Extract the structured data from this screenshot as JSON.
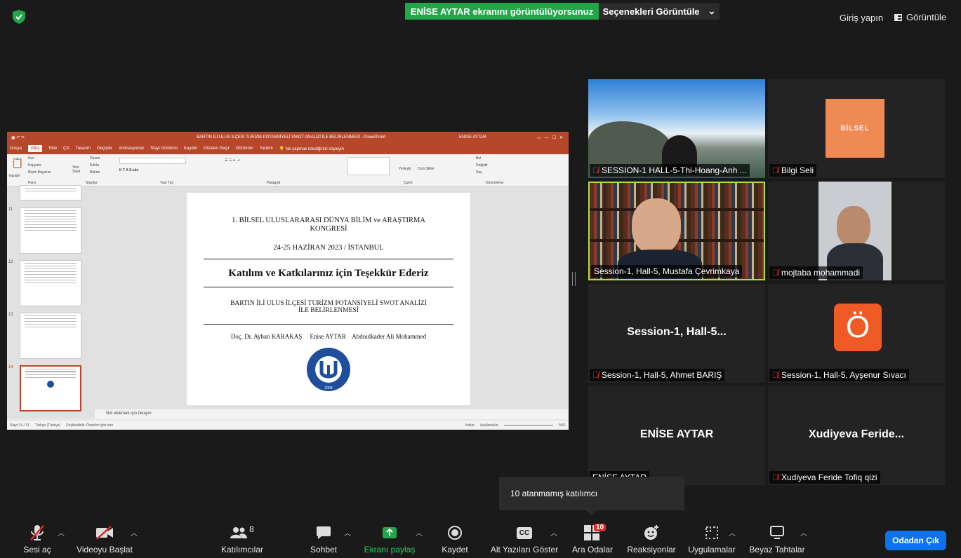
{
  "header": {
    "share_banner": "ENİSE AYTAR ekranını görüntülüyorsunuz",
    "view_options": "Seçenekleri Görüntüle",
    "sign_in": "Giriş yapın",
    "view_button": "Görüntüle"
  },
  "ppt": {
    "title": "BARTIN İLİ ULUS İLÇESİ TURİZM POTANSİYELİ SWOT ANALİZİ İLE BELİRLENMESİ  -  PowerPoint",
    "user": "ENİSE AYTAR",
    "menu": [
      "Dosya",
      "Giriş",
      "Ekle",
      "Çiz",
      "Tasarım",
      "Geçişler",
      "Animasyonlar",
      "Slayt Gösterisi",
      "Kaydet",
      "Gözden Geçir",
      "Görünüm",
      "Yardım"
    ],
    "search_hint": "Ne yapmak istediğinizi söyleyin",
    "ribbon_groups": [
      "Pano",
      "Slaytlar",
      "Yazı Tipi",
      "Paragraf",
      "Çizim",
      "Düzenleme"
    ],
    "ribbon_items": {
      "cut": "Kes",
      "copy": "Kopyala",
      "format_painter": "Biçim Boyacısı",
      "paste": "Yapıştır",
      "new_slide": "Yeni Slayt",
      "layout": "Düzen",
      "reset": "Sıfırla",
      "section": "Bölüm",
      "find": "Bul",
      "replace": "Değiştir",
      "select": "Seç",
      "arrange": "Yerleştir",
      "quick_styles": "Hızlı Stiller"
    },
    "thumb_numbers": [
      "11",
      "12",
      "13",
      "14"
    ],
    "notes_placeholder": "Not eklemek için tıklayın",
    "status_left": "Slayt 14 / 14",
    "status_lang": "Türkçe (Türkiye)",
    "status_access": "Erişilebilirlik: Önerileri göz atın",
    "status_notes": "Notlar",
    "status_comments": "Açıklamalar",
    "zoom": "%61"
  },
  "slide": {
    "line1": "1.  BİLSEL ULUSLARARASI DÜNYA BİLİM ve ARAŞTIRMA",
    "line2": "KONGRESİ",
    "date": "24-25 HAZİRAN 2023 / İSTANBUL",
    "headline": "Katılım ve Katkılarınız için Teşekkür Ederiz",
    "subtitle1": "BARTIN İLİ ULUS İLÇESİ TURİZM POTANSİYELİ SWOT ANALİZİ",
    "subtitle2": "İLE BELİRLENMESİ",
    "authors": "Doç. Dr. Ayhan KARAKAŞ     Enise AYTAR    Abdoulkader Ali Mohammed",
    "logo_year": "2008"
  },
  "tiles": [
    {
      "name": "SESSION-1 HALL-5-Thi-Hoang-Anh ...",
      "muted": true
    },
    {
      "name": "Bilgi Seli",
      "muted": true,
      "logo_text": "BİLSEL"
    },
    {
      "name": "Session-1, Hall-5, Mustafa Çevrimkaya",
      "muted": false,
      "active": true
    },
    {
      "name": "mojtaba mohammadi",
      "muted": true
    },
    {
      "name": "Session-1, Hall-5, Ahmet BARIŞ",
      "muted": true,
      "center": "Session-1,  Hall-5..."
    },
    {
      "name": "Session-1, Hall-5, Ayşenur Sıvacı",
      "muted": true,
      "avatar": "Ö"
    },
    {
      "name": "ENİSE AYTAR",
      "muted": false,
      "center": "ENİSE AYTAR"
    },
    {
      "name": "Xudiyeva Feride Tofiq qizi",
      "muted": true,
      "center": "Xudiyeva  Feride..."
    }
  ],
  "tooltip": "10 atanmamış katılımcı",
  "toolbar": {
    "unmute": "Sesi aç",
    "start_video": "Videoyu Başlat",
    "participants": "Katılımcılar",
    "participants_count": "8",
    "chat": "Sohbet",
    "share": "Ekranı paylaş",
    "record": "Kaydet",
    "captions": "Alt Yazıları Göster",
    "captions_icon": "CC",
    "breakout": "Ara Odalar",
    "breakout_badge": "10",
    "reactions": "Reaksiyonlar",
    "apps": "Uygulamalar",
    "whiteboards": "Beyaz Tahtalar",
    "leave": "Odadan Çık"
  },
  "colors": {
    "share_green": "#23a64a",
    "ppt_red": "#b7472a",
    "leave_blue": "#0e72ed",
    "active_speaker": "#a8e04a",
    "muted_red": "#e02828",
    "avatar_orange": "#f05a24"
  }
}
